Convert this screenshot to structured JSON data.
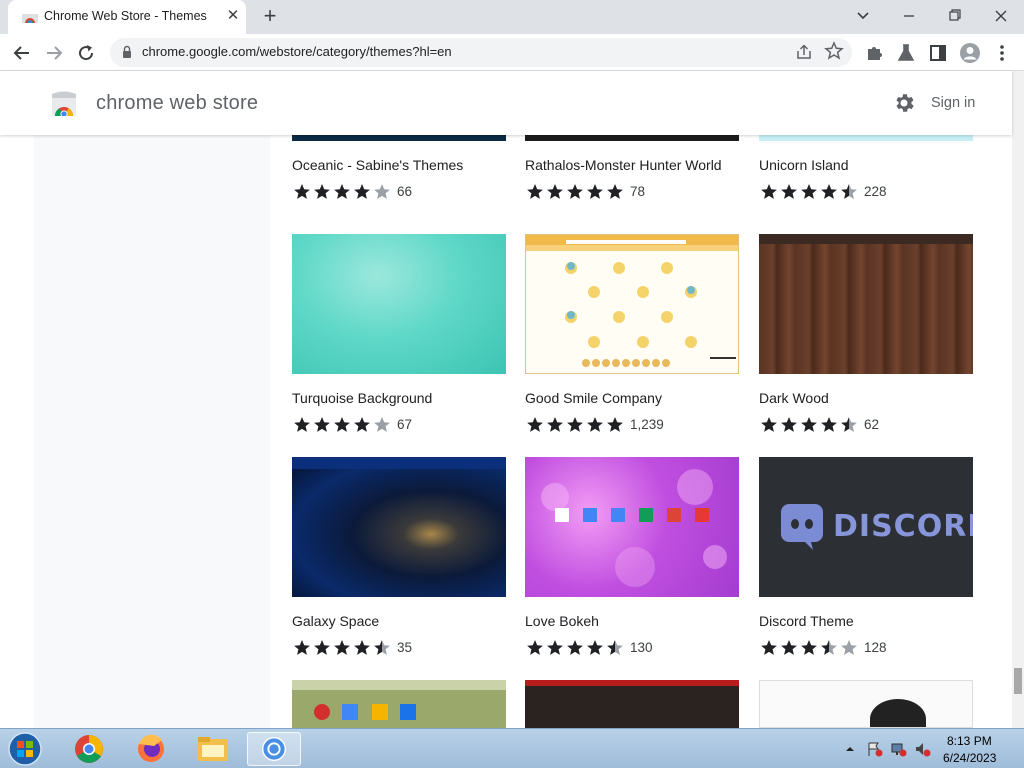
{
  "browser": {
    "tab_title": "Chrome Web Store - Themes",
    "close_label": "✕",
    "new_tab_label": "+",
    "url": "chrome.google.com/webstore/category/themes?hl=en"
  },
  "store": {
    "title": "chrome web store",
    "signin": "Sign in"
  },
  "themes": [
    {
      "name": "Oceanic - Sabine's Themes",
      "rating": 4,
      "count": "66"
    },
    {
      "name": "Rathalos-Monster Hunter World",
      "rating": 5,
      "count": "78"
    },
    {
      "name": "Unicorn Island",
      "rating": 4.5,
      "count": "228"
    },
    {
      "name": "Turquoise Background",
      "rating": 4,
      "count": "67"
    },
    {
      "name": "Good Smile Company",
      "rating": 5,
      "count": "1,239"
    },
    {
      "name": "Dark Wood",
      "rating": 4.5,
      "count": "62"
    },
    {
      "name": "Galaxy Space",
      "rating": 4.5,
      "count": "35"
    },
    {
      "name": "Love Bokeh",
      "rating": 4.5,
      "count": "130"
    },
    {
      "name": "Discord Theme",
      "rating": 3.5,
      "count": "128"
    }
  ],
  "discord_logo_text": "DISCORD",
  "taskbar": {
    "time": "8:13 PM",
    "date": "6/24/2023"
  },
  "colors": {
    "star": "#202124",
    "star_empty": "#9aa0a6"
  }
}
